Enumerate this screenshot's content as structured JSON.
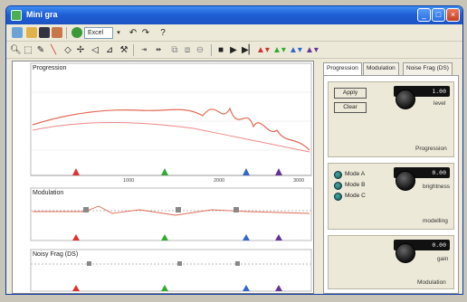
{
  "window": {
    "title": "Mini gra"
  },
  "toolbar": {
    "zoom_value": "Excel"
  },
  "graphs": {
    "panels": [
      {
        "title": "Progression"
      },
      {
        "title": "Modulation"
      },
      {
        "title": "Noisy Frag (DS)"
      }
    ],
    "x_ticks": [
      "",
      "1000",
      "2000",
      "3000"
    ]
  },
  "side": {
    "tabs": [
      "Progression",
      "Modulation",
      "Noise Frag (DS)"
    ],
    "buttons": [
      "Apply",
      "Clear"
    ],
    "groups": [
      {
        "lcd": "1.00",
        "knob_label": "level",
        "caption": "Progression"
      },
      {
        "lcd": "0.00",
        "knob_label": "brightness",
        "caption": "modelling",
        "modes": [
          "Mode A",
          "Mode B",
          "Mode C"
        ]
      },
      {
        "lcd": "0.00",
        "knob_label": "gain",
        "caption": "Modulation"
      }
    ]
  },
  "colors": {
    "trace": "#e06a55",
    "title_blue": "#1f5fd6"
  }
}
